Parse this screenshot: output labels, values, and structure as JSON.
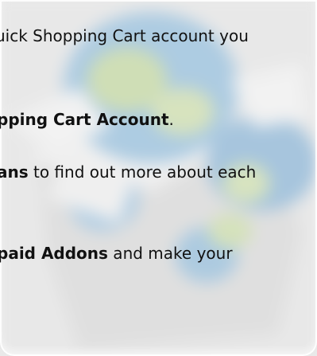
{
  "paragraphs": {
    "line1": {
      "text": "uick Shopping Cart account you"
    },
    "line2": {
      "bold": "pping Cart Account",
      "rest": "."
    },
    "line3": {
      "bold": "ans",
      "rest": " to find out more about each"
    },
    "line4": {
      "bold": "paid Addons",
      "rest": " and make your"
    }
  },
  "colors": {
    "text": "#111111",
    "background": "#ececec",
    "illustration_blue": "#6aa8d8",
    "illustration_green": "#b9d48a",
    "illustration_white": "#f6f6f6"
  }
}
